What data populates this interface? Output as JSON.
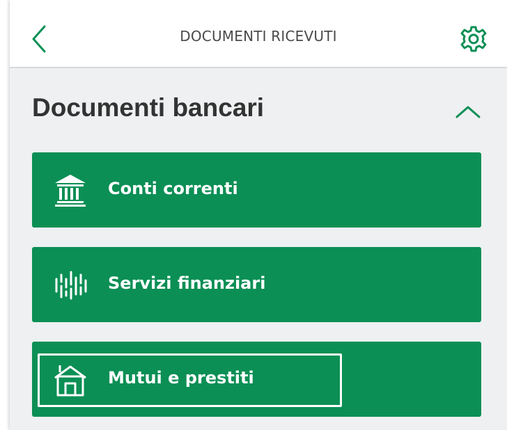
{
  "header": {
    "title": "DOCUMENTI RICEVUTI",
    "back_icon": "chevron-left-icon",
    "settings_icon": "gear-icon"
  },
  "section": {
    "title": "Documenti bancari",
    "toggle_icon": "chevron-up-icon",
    "expanded": true
  },
  "items": [
    {
      "label": "Conti correnti",
      "icon": "bank-building-icon"
    },
    {
      "label": "Servizi finanziari",
      "icon": "chart-bars-icon"
    },
    {
      "label": "Mutui e prestiti",
      "icon": "house-icon",
      "highlighted": true
    }
  ],
  "colors": {
    "accent": "#0b8f55",
    "background": "#eef0f1",
    "header_bg": "#ffffff",
    "title_text": "#333333",
    "item_text": "#ffffff"
  }
}
